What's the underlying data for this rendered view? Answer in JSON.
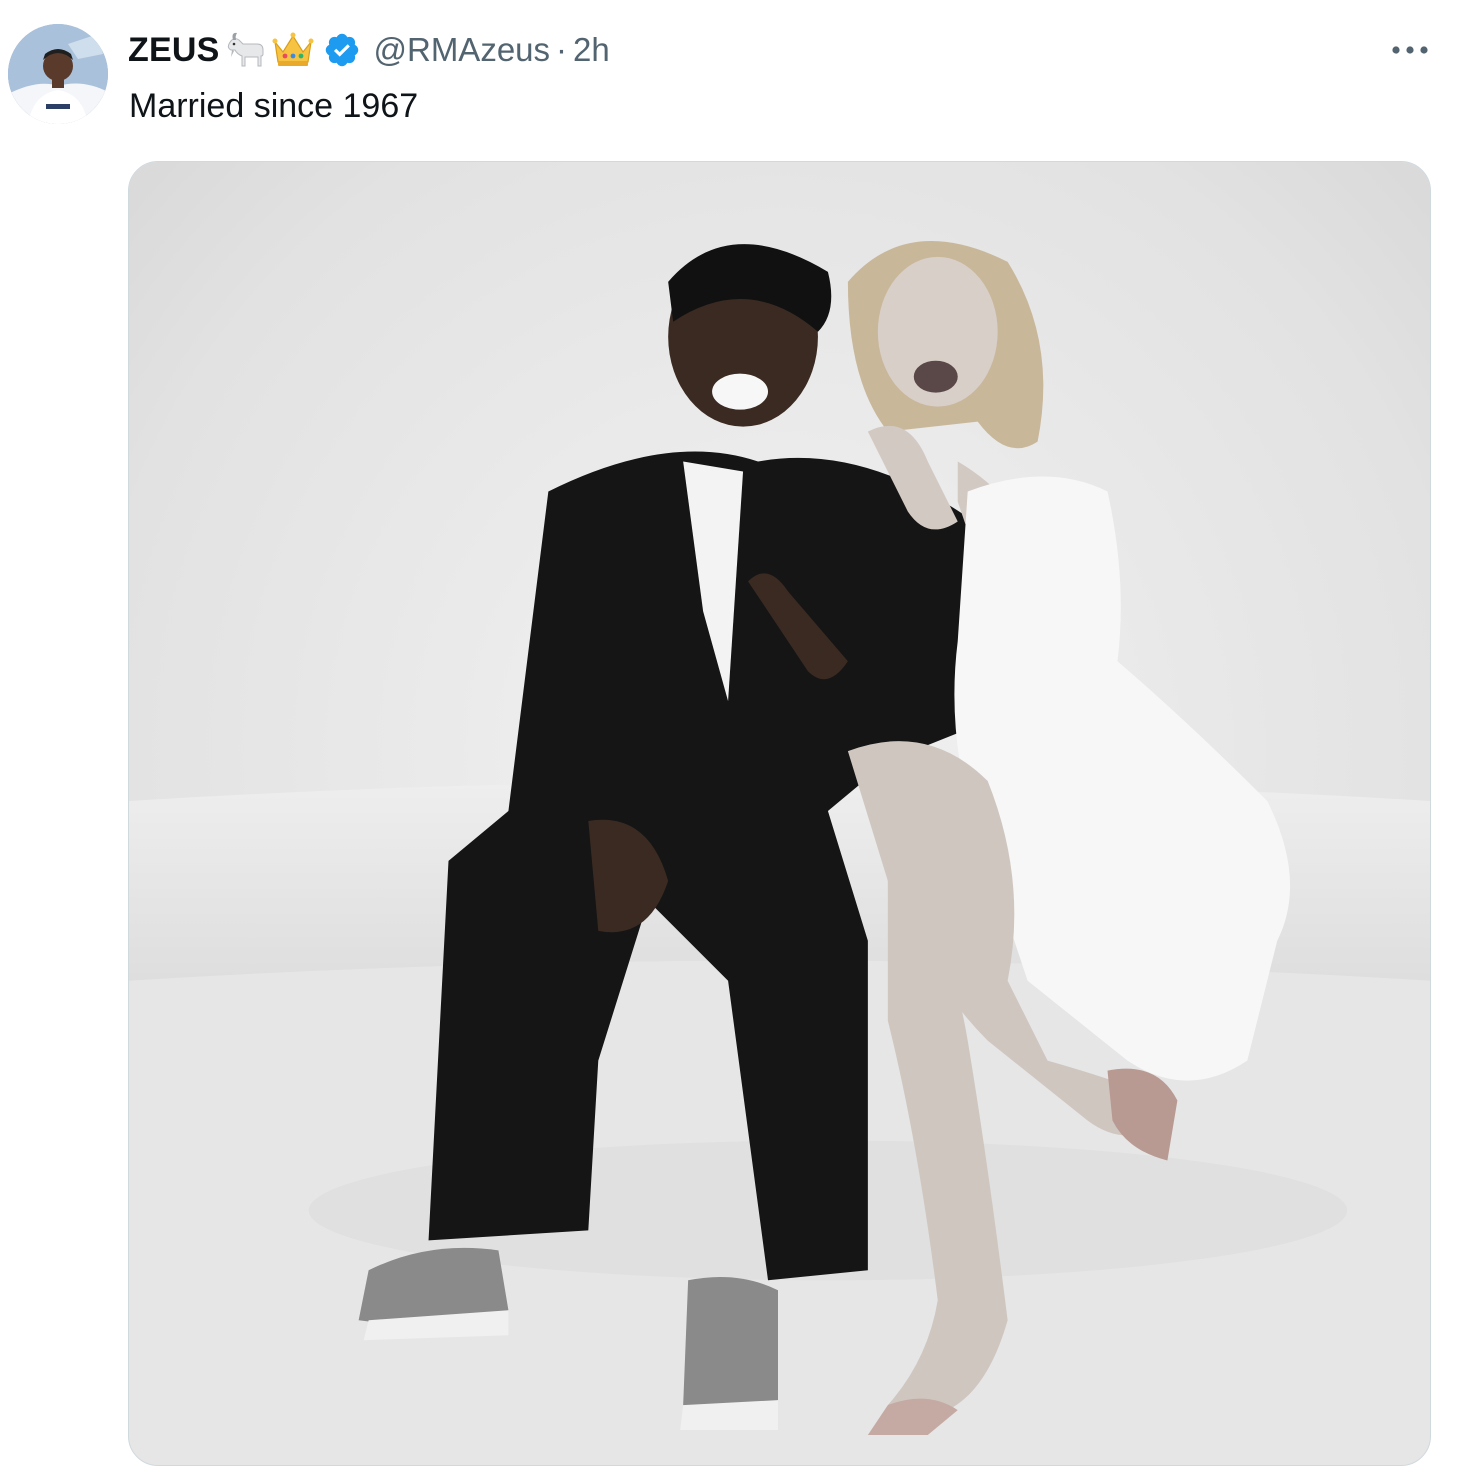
{
  "tweet": {
    "display_name": "ZEUS",
    "name_emojis": [
      "goat-emoji",
      "crown-emoji"
    ],
    "verified": true,
    "handle": "@RMAzeus",
    "separator": "·",
    "time": "2h",
    "text": "Married since 1967",
    "more_icon": "more-icon"
  },
  "colors": {
    "verified_blue": "#1d9bf0",
    "secondary_text": "#536471",
    "primary_text": "#0f1419"
  }
}
